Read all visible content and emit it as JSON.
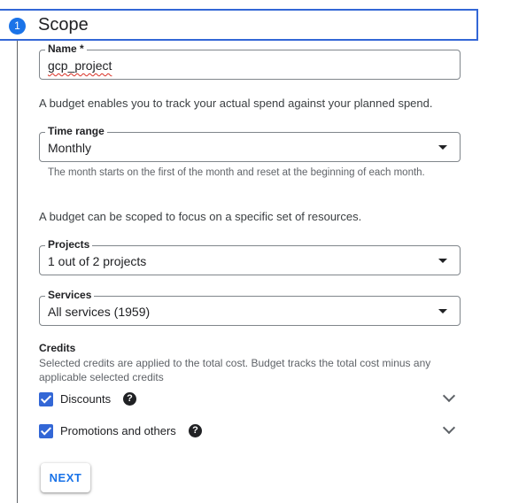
{
  "step": {
    "number": "1",
    "title": "Scope"
  },
  "name_field": {
    "label": "Name *",
    "value": "gcp_project"
  },
  "budget_description": "A budget enables you to track your actual spend against your planned spend.",
  "time_range": {
    "label": "Time range",
    "value": "Monthly",
    "hint": "The month starts on the first of the month and reset at the beginning of each month."
  },
  "scope_description": "A budget can be scoped to focus on a specific set of resources.",
  "projects": {
    "label": "Projects",
    "value": "1 out of 2 projects"
  },
  "services": {
    "label": "Services",
    "value": "All services (1959)"
  },
  "credits": {
    "title": "Credits",
    "description": "Selected credits are applied to the total cost. Budget tracks the total cost minus any applicable selected credits",
    "items": [
      {
        "label": "Discounts",
        "checked": true
      },
      {
        "label": "Promotions and others",
        "checked": true
      }
    ]
  },
  "actions": {
    "next_label": "NEXT"
  },
  "colors": {
    "accent": "#1a73e8",
    "checkbox": "#3367d6",
    "header_border": "#3367d6"
  }
}
